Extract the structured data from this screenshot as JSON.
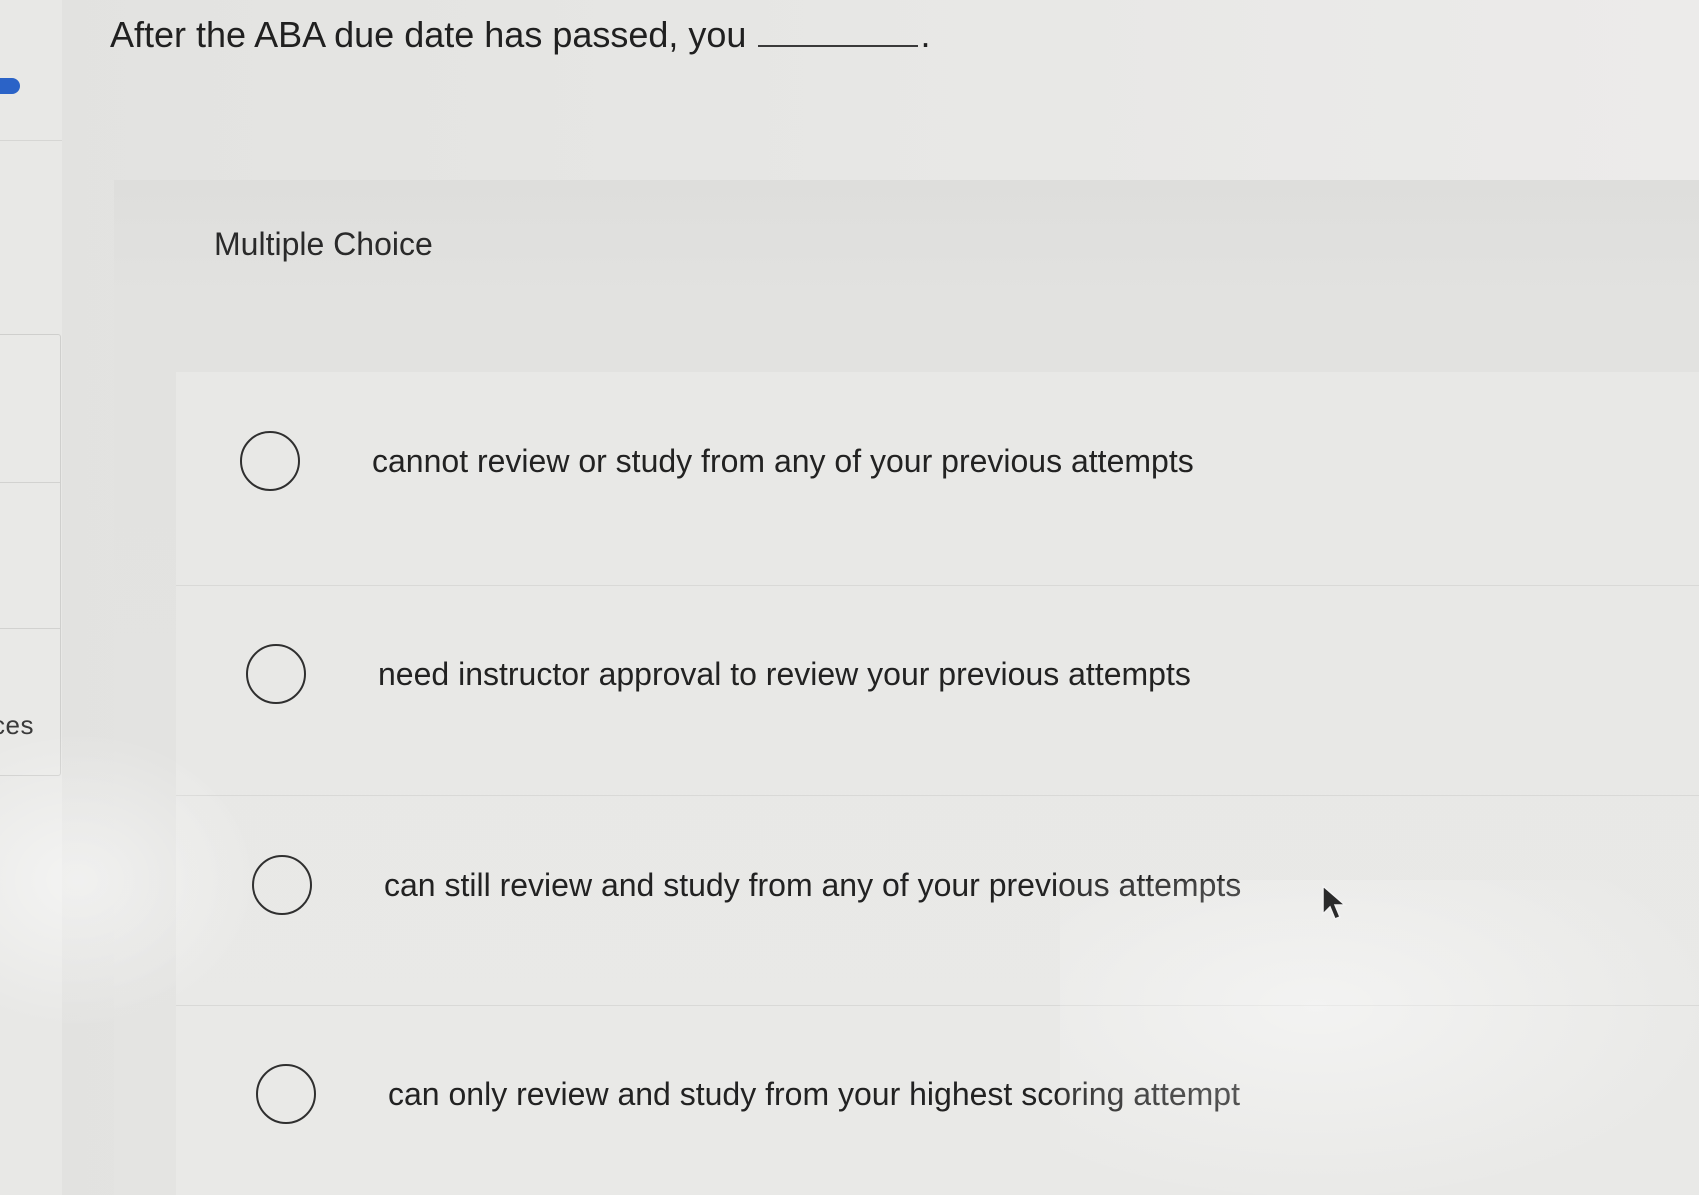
{
  "question": {
    "text": "After the ABA due date has passed, you",
    "blank_period": "."
  },
  "card": {
    "title": "Multiple Choice"
  },
  "choices": [
    {
      "label": "cannot review or study from any of your previous attempts",
      "selected": false
    },
    {
      "label": "need instructor approval to review your previous attempts",
      "selected": false
    },
    {
      "label": "can still review and study from any of your previous attempts",
      "selected": false
    },
    {
      "label": "can only review and study from your highest scoring attempt",
      "selected": false
    }
  ],
  "sidebar": {
    "partial_label": "ces",
    "accent_color": "#2b63c7"
  },
  "icons": {
    "cursor": "mouse-pointer-icon",
    "radio": "radio-circle-icon"
  }
}
